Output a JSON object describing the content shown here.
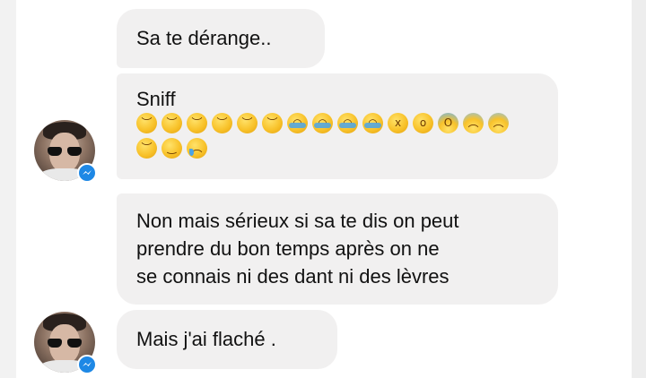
{
  "conversation": {
    "messages": [
      {
        "text": "Sa te dérange.."
      },
      {
        "text": "Sniff",
        "emoji_rows": [
          [
            "disappointed-face",
            "disappointed-face",
            "disappointed-face",
            "disappointed-face",
            "disappointed-face",
            "disappointed-face",
            "loudly-crying-face",
            "loudly-crying-face",
            "loudly-crying-face",
            "loudly-crying-face",
            "dizzy-face",
            "astonished-face",
            "screaming-in-fear-face",
            "anxious-face-with-sweat",
            "anxious-face-with-sweat"
          ],
          [
            "downcast-face-with-sweat",
            "sleepy-face",
            "crying-face"
          ]
        ]
      },
      {
        "lines": [
          "Non mais sérieux si sa te dis on peut",
          "prendre du bon temps après on ne",
          "se connais ni des dant ni des lèvres"
        ]
      },
      {
        "text": "Mais j'ai flaché ."
      }
    ],
    "sender": {
      "avatar_icon": "profile-photo",
      "badge_icon": "messenger-icon"
    }
  },
  "colors": {
    "bubble": "#f1f0f0",
    "text": "#111111",
    "badge": "#1e88e5"
  }
}
